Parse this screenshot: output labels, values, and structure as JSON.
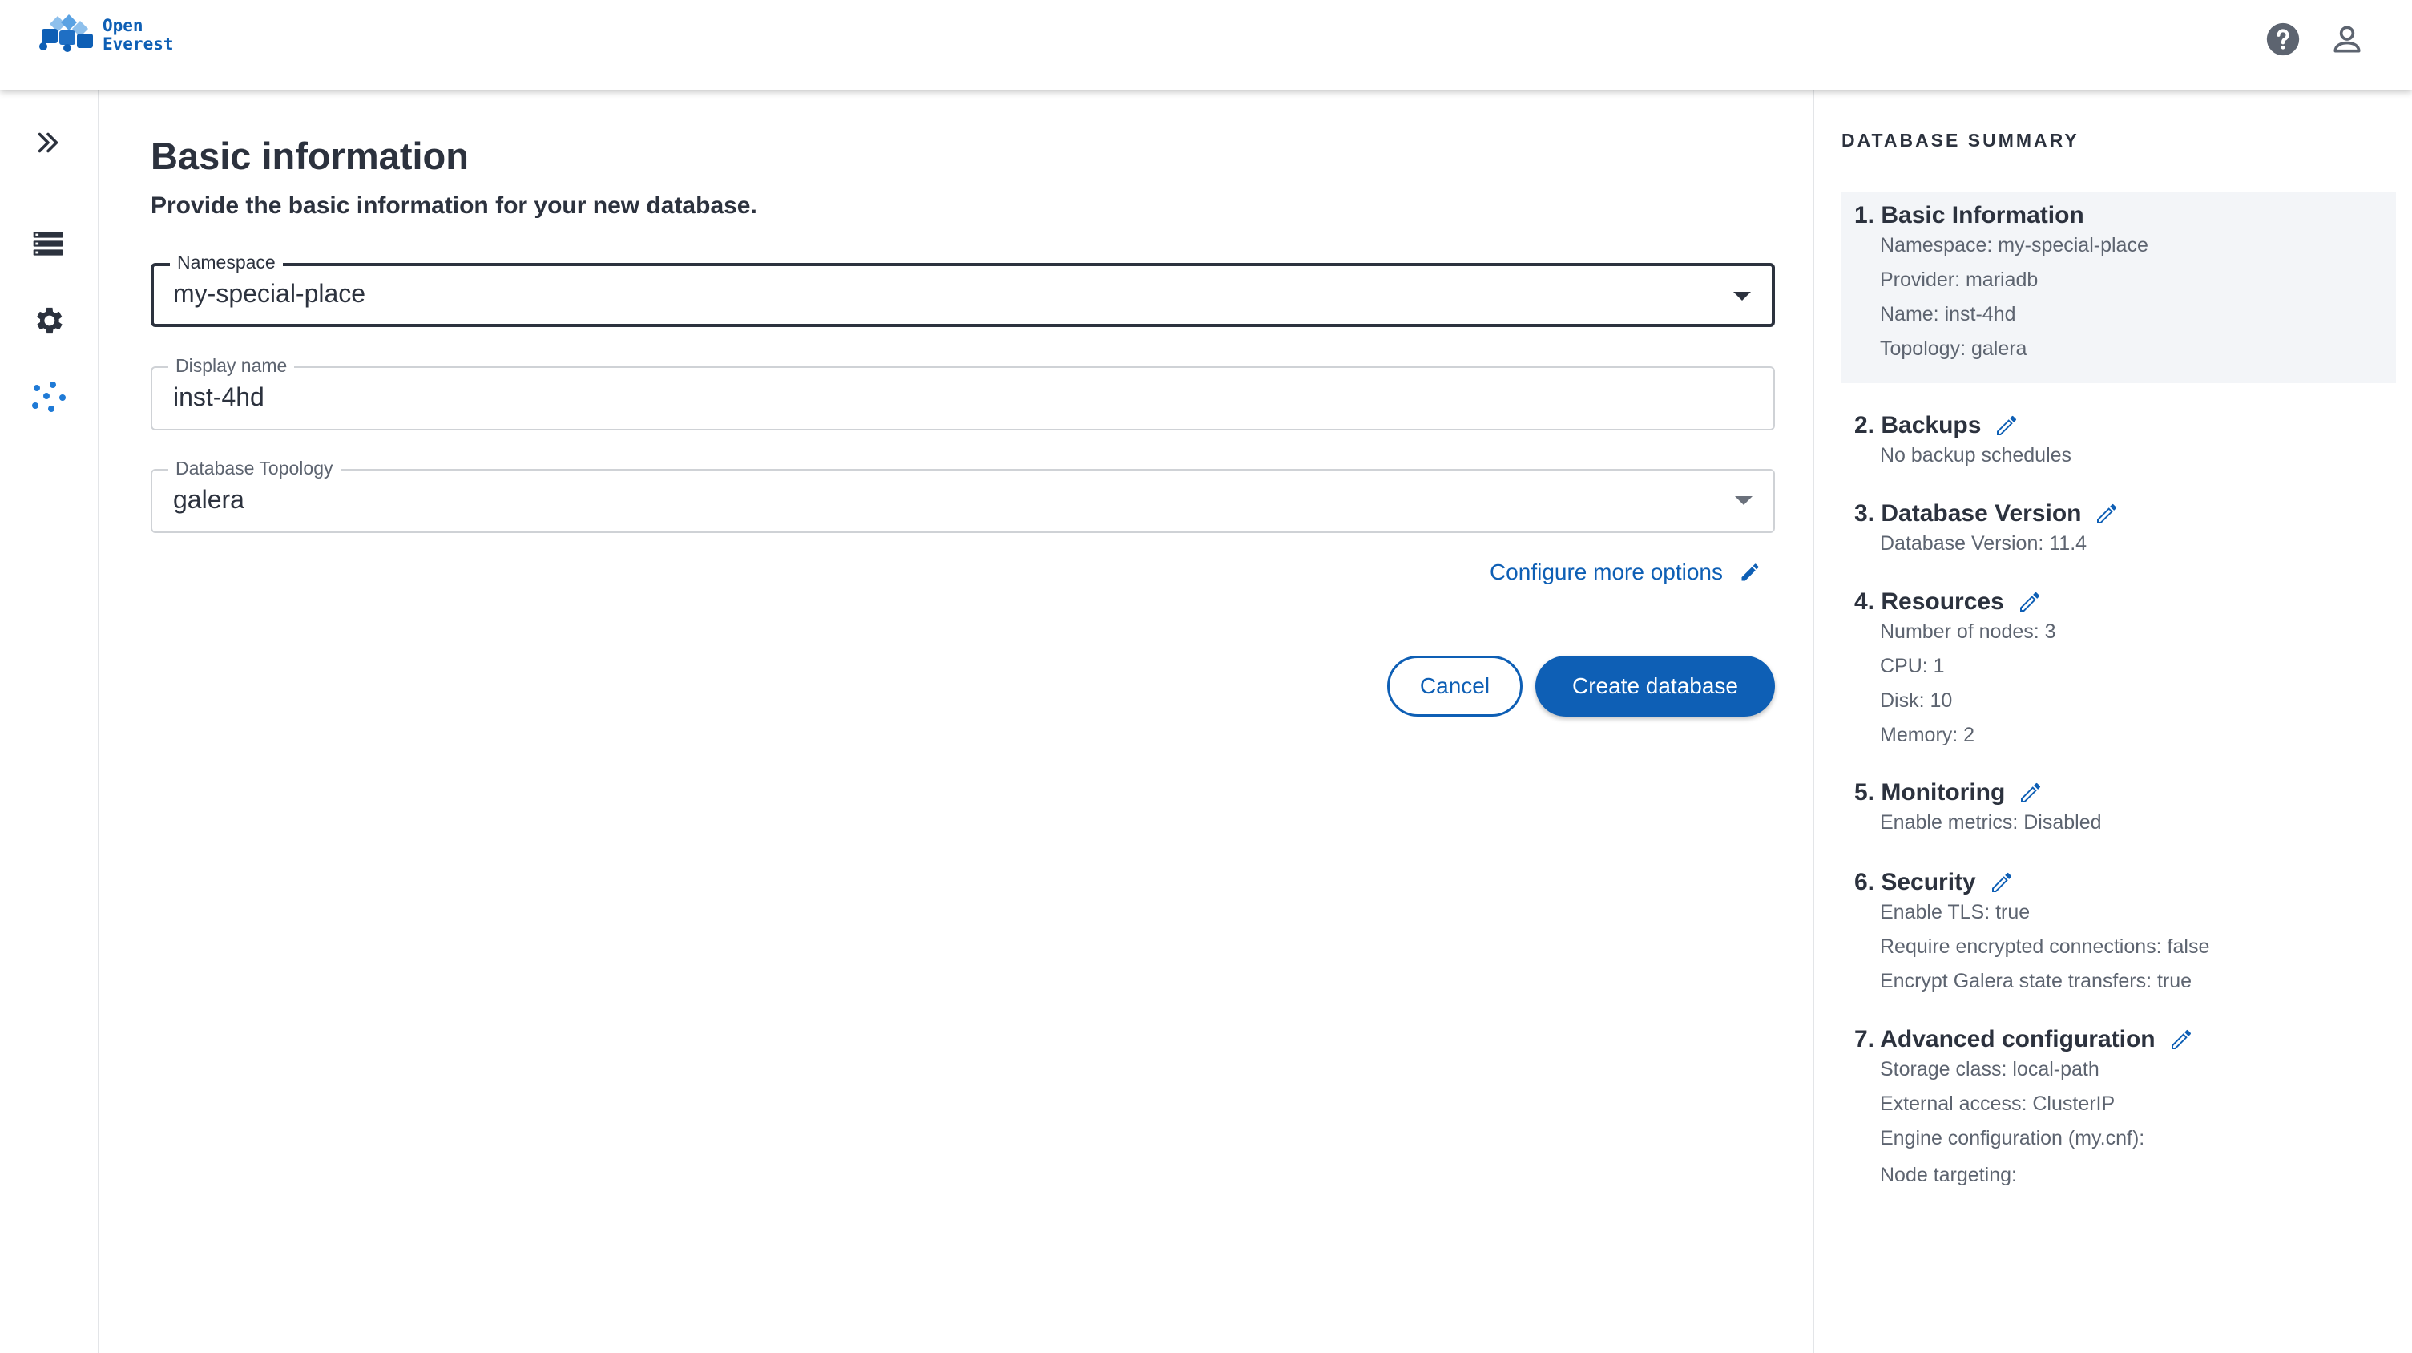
{
  "brand": {
    "line1": "Open",
    "line2": "Everest",
    "accent": "#0e5fb5"
  },
  "header": {
    "icons": [
      "help-icon",
      "user-icon"
    ]
  },
  "nav": {
    "items": [
      "expand-icon",
      "databases-icon",
      "settings-icon",
      "cluster-icon"
    ]
  },
  "main": {
    "title": "Basic information",
    "subtitle": "Provide the basic information for your new database.",
    "fields": {
      "namespace": {
        "label": "Namespace",
        "value": "my-special-place"
      },
      "display_name": {
        "label": "Display name",
        "value": "inst-4hd"
      },
      "topology": {
        "label": "Database Topology",
        "value": "galera"
      }
    },
    "configure_link": "Configure more options",
    "cancel_label": "Cancel",
    "create_label": "Create database"
  },
  "summary": {
    "title": "DATABASE SUMMARY",
    "sections": [
      {
        "title": "1. Basic Information",
        "lines": [
          "Namespace: my-special-place",
          "Provider: mariadb",
          "Name: inst-4hd",
          "Topology: galera"
        ]
      },
      {
        "title": "2. Backups",
        "lines": [
          "No backup schedules"
        ]
      },
      {
        "title": "3. Database Version",
        "lines": [
          "Database Version: 11.4"
        ]
      },
      {
        "title": "4. Resources",
        "lines": [
          "Number of nodes: 3",
          "CPU: 1",
          "Disk: 10",
          "Memory: 2"
        ]
      },
      {
        "title": "5. Monitoring",
        "lines": [
          "Enable metrics: Disabled"
        ]
      },
      {
        "title": "6. Security",
        "lines": [
          "Enable TLS: true",
          "Require encrypted connections: false",
          "Encrypt Galera state transfers: true"
        ]
      },
      {
        "title": "7. Advanced configuration",
        "lines": [
          "Storage class: local-path",
          "External access: ClusterIP",
          "Engine configuration (my.cnf):",
          "Node targeting:"
        ]
      }
    ]
  }
}
